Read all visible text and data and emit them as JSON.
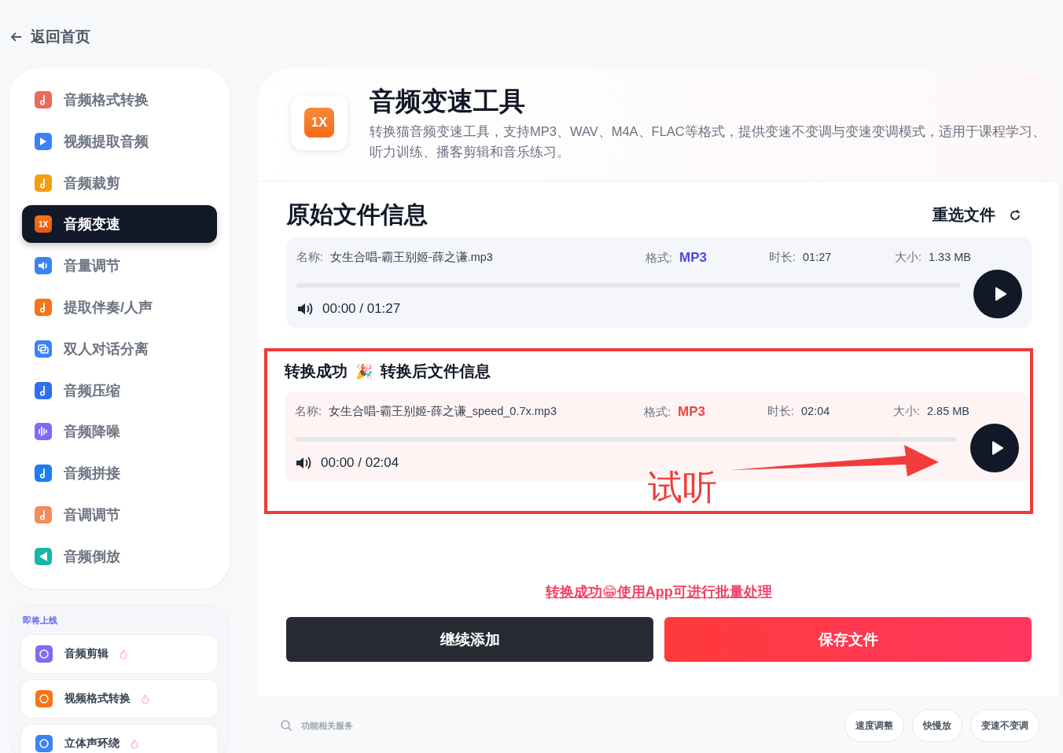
{
  "back": {
    "label": "返回首页"
  },
  "sidebar": {
    "items": [
      {
        "label": "音频格式转换",
        "selected": false
      },
      {
        "label": "视频提取音频",
        "selected": false
      },
      {
        "label": "音频裁剪",
        "selected": false
      },
      {
        "label": "音频变速",
        "selected": true,
        "icon_text": "1X"
      },
      {
        "label": "音量调节",
        "selected": false
      },
      {
        "label": "提取伴奏/人声",
        "selected": false
      },
      {
        "label": "双人对话分离",
        "selected": false
      },
      {
        "label": "音频压缩",
        "selected": false
      },
      {
        "label": "音频降噪",
        "selected": false
      },
      {
        "label": "音频拼接",
        "selected": false
      },
      {
        "label": "音调调节",
        "selected": false
      },
      {
        "label": "音频倒放",
        "selected": false
      }
    ]
  },
  "coming_soon": {
    "title": "即将上线",
    "items": [
      {
        "label": "音频剪辑"
      },
      {
        "label": "视频格式转换"
      },
      {
        "label": "立体声环绕"
      }
    ]
  },
  "tool": {
    "icon_text": "1X",
    "title": "音频变速工具",
    "description": "转换猫音频变速工具，支持MP3、WAV、M4A、FLAC等格式，提供变速不变调与变速变调模式，适用于课程学习、听力训练、播客剪辑和音乐练习。"
  },
  "file_sections": [
    {
      "kind": "original",
      "heading": "原始文件信息",
      "reselect": "重选文件",
      "name_label": "名称:",
      "name": "女生合唱-霸王别姬-薛之谦.mp3",
      "format_label": "格式:",
      "format": "MP3",
      "duration_label": "时长:",
      "duration": "01:27",
      "size_label": "大小:",
      "size": "1.33 MB",
      "time": "00:00 / 01:27",
      "level": 0
    },
    {
      "kind": "converted",
      "status": "转换成功",
      "emoji": "🎉",
      "heading": "转换后文件信息",
      "name_label": "名称:",
      "name": "女生合唱-霸王别姬-薛之谦_speed_0.7x.mp3",
      "format_label": "格式:",
      "format": "MP3",
      "duration_label": "时长:",
      "duration": "02:04",
      "size_label": "大小:",
      "size": "2.85 MB",
      "time": "00:00 / 02:04",
      "level": 0,
      "annotation": "试听"
    }
  ],
  "promo_link": "转换成功😁使用App可进行批量处理",
  "buttons": [
    {
      "label": "继续添加",
      "kind": "secondary"
    },
    {
      "label": "保存文件",
      "kind": "primary"
    }
  ],
  "footer": {
    "search_placeholder": "功能相关服务",
    "tags": [
      "速度调整",
      "快慢放",
      "变速不变调"
    ]
  }
}
